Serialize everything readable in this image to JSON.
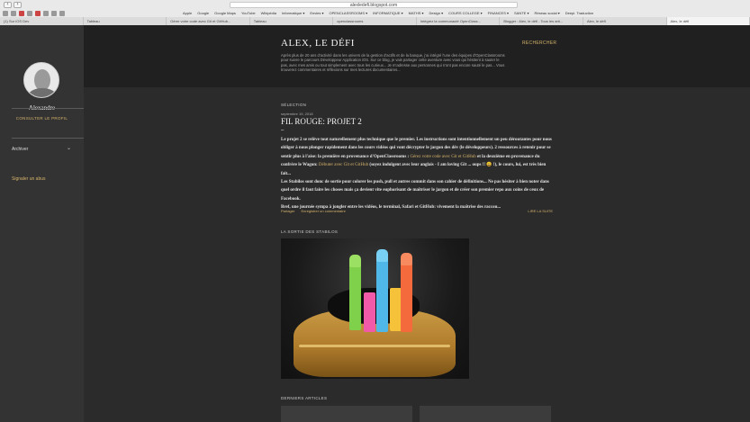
{
  "browser": {
    "url": "alexledefi.blogspot.com",
    "nav_back": "‹",
    "nav_forward": "›",
    "bookmarks": [
      "Apple",
      "Google",
      "Google Maps",
      "YouTube",
      "Wikipédia",
      "Informatique ▾",
      "Envies ▾",
      "OPENCLASSROOMS ▾",
      "INFORMATIQUE ▾",
      "MATHS ▾",
      "Design ▾",
      "COURS COLLEGE ▾",
      "FINANCES ▾",
      "SANTE ▾",
      "Réseau social ▾",
      "Deepl. Traduction"
    ],
    "tabs": [
      "(1) Sur iOS Dev",
      "Tableau",
      "Gérer votre code avec Git et GitHub...",
      "Tableau",
      "openclassrooms",
      "Intégrez la communauté OpenClass...",
      "Blogger : Alex, le défi - Tous les arti...",
      "Alex, le défi",
      "Alex, le défi"
    ],
    "active_tab_index": 8
  },
  "header": {
    "title": "ALEX, LE DÉFI",
    "search_label": "RECHERCHER",
    "description": "Après plus de 20 ans d'activité dans les univers de la gestion d'actifs et de la banque, j'ai intégré l'une des équipes d'OpenClassrooms pour suivre le parcours Développeur Application iOS. Sur ce blog, je vais partager cette aventure avec vous qui hésitent à sauter le pas, avec mes amis ou tout simplement avec tous les curieux... Je m'adresse aux personnes qui n'ont pas encore sauté le pas... Vous trouverez commentaires et réflexions sur mes lectures documentaires..."
  },
  "sidebar": {
    "author": "Alexandre",
    "profile_link": "CONSULTER LE PROFIL",
    "archive_label": "Archiver",
    "report_link": "Signaler un abus"
  },
  "post": {
    "section": "SÉLECTION",
    "date": "septembre 19, 2018",
    "title": "FIL ROUGE: PROJET 2",
    "dash": "–",
    "body_1": "Le projet 2 se relève tout naturellement plus technique que le premier. Les instructions sont intentionnellement un peu déroutantes pour nous obliger à nous plonger rapidement dans les cours vidéos qui vont décrypter le jargon des dév (le développeurs). 2 ressources à retenir pour se sentir plus à l'aise: la première en provenance d'OpenClassrooms : ",
    "link_1": "Gérez votre code avec Git et GitHub",
    "body_2": " et la deuxième en provenance du confrère le Wagon: ",
    "link_2": "Débuter avec Git et GitHub",
    "body_3": " (soyez indulgent avec leur anglais - I am loving Git ... oups !! 😀 !), le cours, lui, est très bien fait...",
    "body_4": "Les Stabilos sont donc de sortie pour colorer les push, pull et autres commit dans son cahier de définitions... Ne pas hésiter à bien noter dans quel ordre il faut faire les choses mais ça devient vite euphorisant de maîtriser le jargon et de créer son premier repo aux coins de ceux de Facebook.",
    "body_5": "Bref, une journée sympa à jongler entre les vidéos, le terminal, Safari et GitHub: vivement la maîtrise des raccou...",
    "share": "Partager",
    "comment": "Enregistrer un commentaire",
    "read_more": "LIRE LA SUITE"
  },
  "photo_section": {
    "title": "LA SORTIE DES STABILOS"
  },
  "recent": {
    "title": "DERNIERS ARTICLES"
  },
  "colors": {
    "accent": "#d6b36b",
    "page_bg": "#2b2b2b",
    "sidebar_bg": "#333333",
    "header_bg": "#202020"
  },
  "icons": [
    "back-icon",
    "forward-icon",
    "chevron-down-icon"
  ]
}
